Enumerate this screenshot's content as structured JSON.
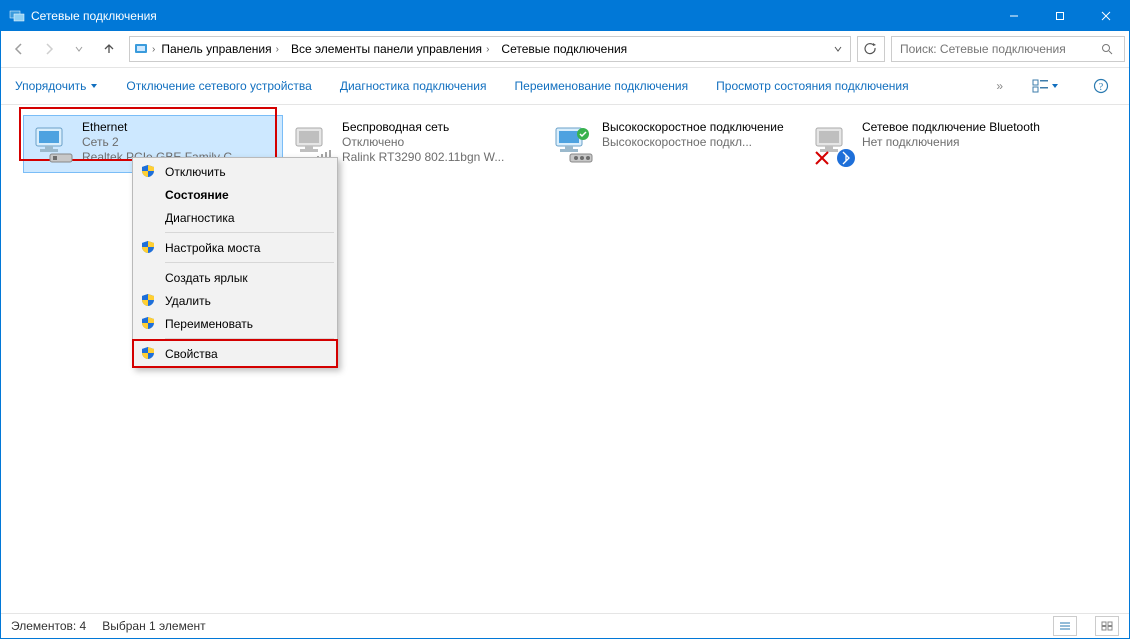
{
  "window": {
    "title": "Сетевые подключения"
  },
  "breadcrumb": {
    "items": [
      "Панель управления",
      "Все элементы панели управления",
      "Сетевые подключения"
    ]
  },
  "search": {
    "placeholder": "Поиск: Сетевые подключения"
  },
  "cmdbar": {
    "organize": "Упорядочить",
    "disable": "Отключение сетевого устройства",
    "diagnose": "Диагностика подключения",
    "rename": "Переименование подключения",
    "status": "Просмотр состояния подключения"
  },
  "connections": [
    {
      "name": "Ethernet",
      "line1": "Сеть  2",
      "line2": "Realtek PCIe GBE Family C..."
    },
    {
      "name": "Беспроводная сеть",
      "line1": "Отключено",
      "line2": "Ralink RT3290 802.11bgn W..."
    },
    {
      "name": "Высокоскоростное подключение",
      "line1": "Высокоскоростное подкл...",
      "line2": ""
    },
    {
      "name": "Сетевое подключение Bluetooth",
      "line1": "Нет подключения",
      "line2": ""
    }
  ],
  "context_menu": {
    "disable": "Отключить",
    "status": "Состояние",
    "diagnose": "Диагностика",
    "bridge": "Настройка моста",
    "shortcut": "Создать ярлык",
    "delete": "Удалить",
    "rename": "Переименовать",
    "properties": "Свойства"
  },
  "statusbar": {
    "count_label": "Элементов: 4",
    "selection_label": "Выбран 1 элемент"
  }
}
